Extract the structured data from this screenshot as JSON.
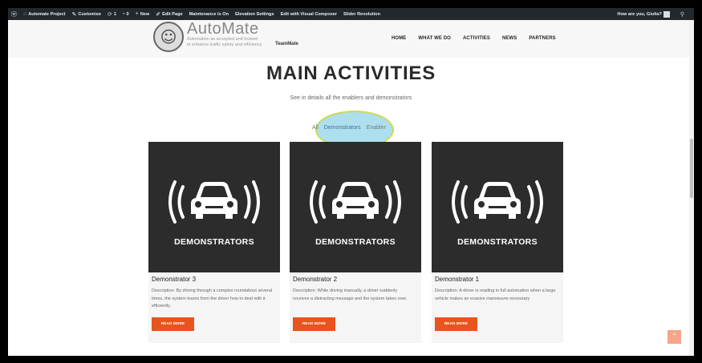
{
  "admin_bar": {
    "site_name": "Automate Project",
    "customise": "Customise",
    "updates_count": "1",
    "comments_count": "0",
    "new": "New",
    "edit_page": "Edit Page",
    "maintenance": "Maintenance is On",
    "elevation": "Elevation Settings",
    "visual_composer": "Edit with Visual Composer",
    "slider": "Slider Revolution",
    "greeting": "How are you, Giulia?"
  },
  "header": {
    "logo_title": "AutoMate",
    "logo_tagline_1": "Automation as accepted and trusted",
    "logo_tagline_2": "to enhance traffic safety and efficiency",
    "logo_team": "TeamMate",
    "nav": [
      "HOME",
      "WHAT WE DO",
      "ACTIVITIES",
      "NEWS",
      "PARTNERS"
    ]
  },
  "main": {
    "title": "MAIN ACTIVITIES",
    "subtitle": "See in details all the enablers and demonstrators",
    "filters": [
      "All",
      "Demonstrators",
      "Enabler"
    ],
    "active_filter": "Demonstrators"
  },
  "cards": [
    {
      "image_caption": "DEMONSTRATORS",
      "title": "Demonstrator 3",
      "description": "Description: By driving through a complex roundabout several times, the system learns from the driver how to deal with it efficiently.",
      "button": "READ MORE"
    },
    {
      "image_caption": "DEMONSTRATORS",
      "title": "Demonstrator 2",
      "description": "Description: While driving manually, a driver suddenly receives a distracting message and the system takes over.",
      "button": "READ MORE"
    },
    {
      "image_caption": "DEMONSTRATORS",
      "title": "Demonstrator 1",
      "description": "Description: A driver is reading in full automation when a large vehicle makes an evasive manoeuvre necessary",
      "button": "READ MORE"
    }
  ],
  "colors": {
    "accent": "#e8541e",
    "admin_bar": "#23282d",
    "card_image_bg": "#2c2c2c",
    "highlight": "#6cc4e2"
  },
  "icons": {
    "wordpress": "wordpress-icon",
    "car_signal": "car-signal-icon",
    "back_to_top": "chevron-up-icon"
  }
}
